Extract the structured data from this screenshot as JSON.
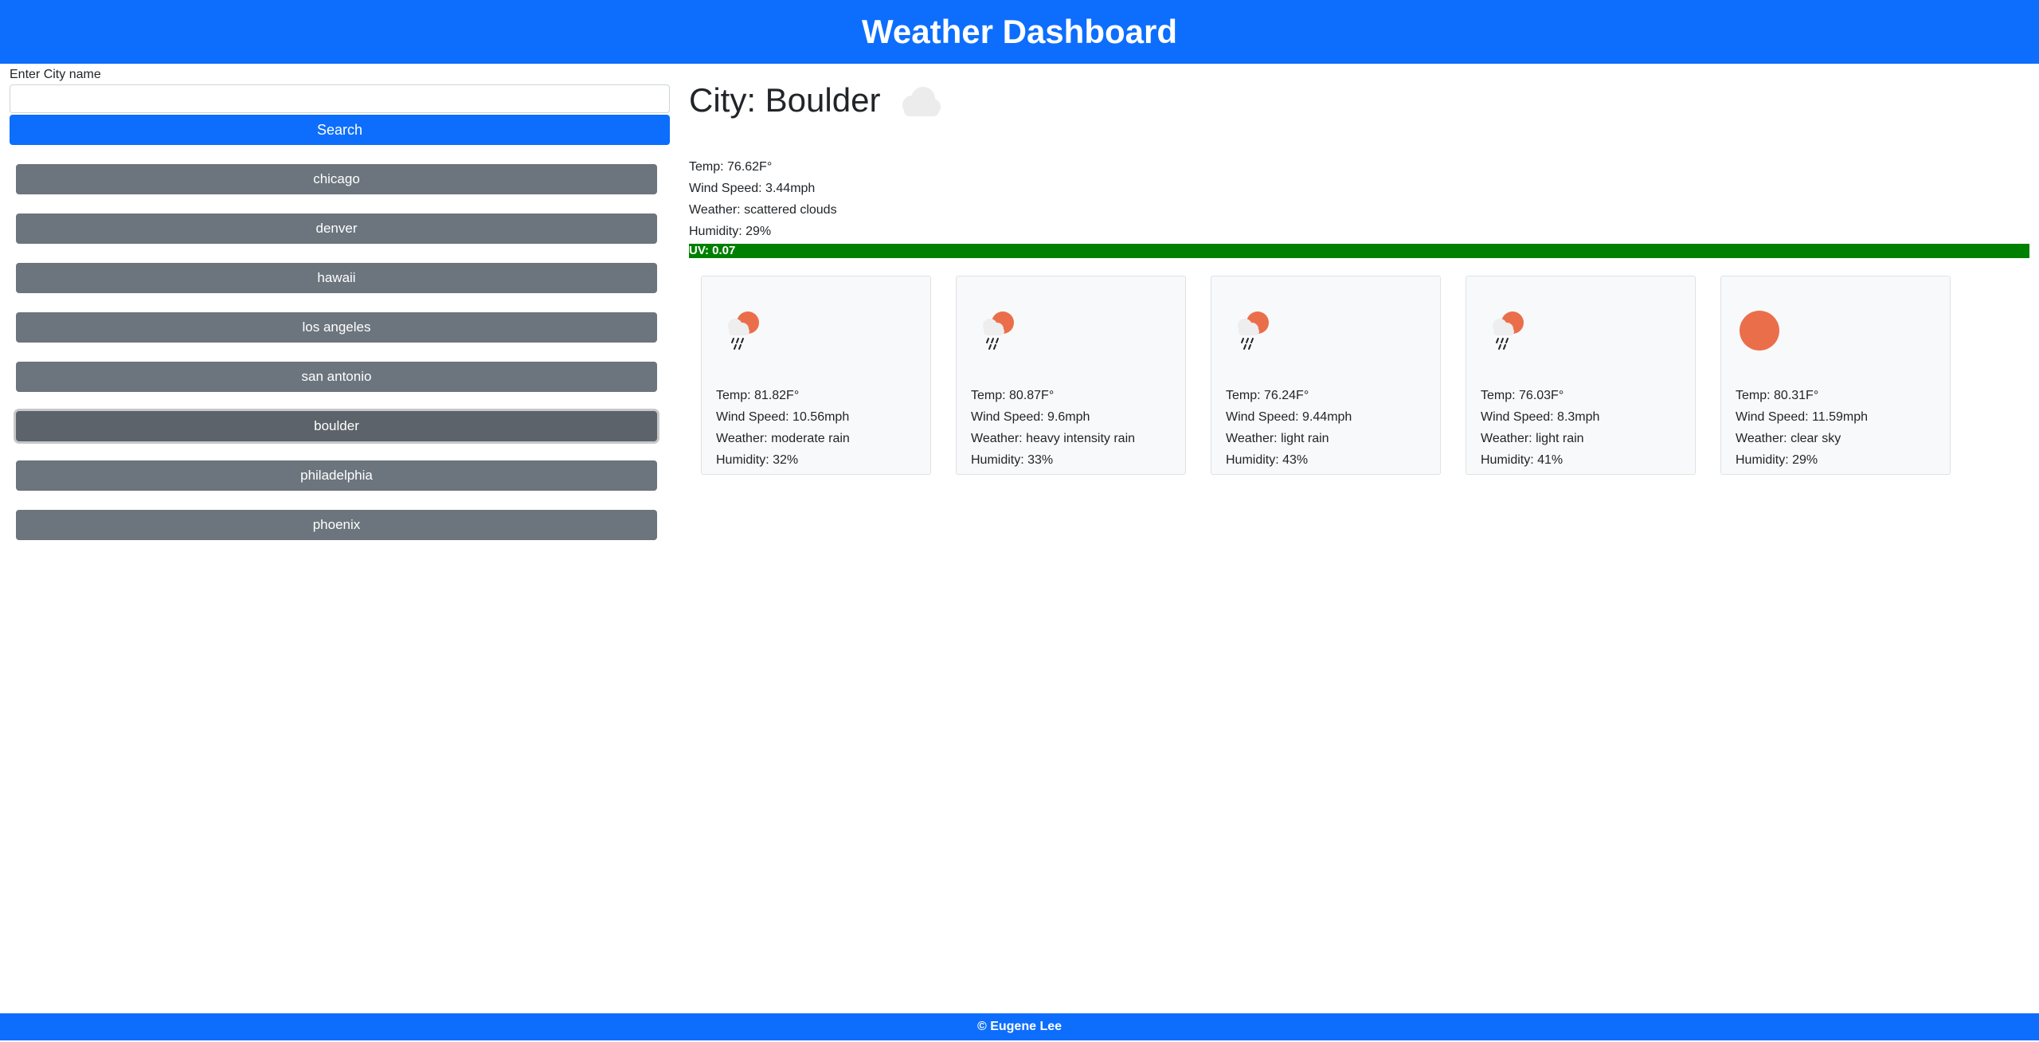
{
  "header": {
    "title": "Weather Dashboard"
  },
  "search": {
    "label": "Enter City name",
    "value": "",
    "placeholder": "",
    "button_label": "Search"
  },
  "history": [
    {
      "label": "chicago",
      "active": false
    },
    {
      "label": "denver",
      "active": false
    },
    {
      "label": "hawaii",
      "active": false
    },
    {
      "label": "los angeles",
      "active": false
    },
    {
      "label": "san antonio",
      "active": false
    },
    {
      "label": "boulder",
      "active": true
    },
    {
      "label": "philadelphia",
      "active": false
    },
    {
      "label": "phoenix",
      "active": false
    }
  ],
  "current": {
    "title": "City: Boulder",
    "icon": "cloud-icon",
    "temp": "Temp: 76.62F°",
    "wind": "Wind Speed: 3.44mph",
    "weather": "Weather: scattered clouds",
    "humidity": "Humidity: 29%",
    "uv": "UV: 0.07",
    "uv_color": "#008000"
  },
  "forecast": [
    {
      "icon": "sun-rain-icon",
      "temp": "Temp: 81.82F°",
      "wind": "Wind Speed: 10.56mph",
      "weather": "Weather: moderate rain",
      "humidity": "Humidity: 32%"
    },
    {
      "icon": "sun-rain-icon",
      "temp": "Temp: 80.87F°",
      "wind": "Wind Speed: 9.6mph",
      "weather": "Weather: heavy intensity rain",
      "humidity": "Humidity: 33%"
    },
    {
      "icon": "sun-rain-icon",
      "temp": "Temp: 76.24F°",
      "wind": "Wind Speed: 9.44mph",
      "weather": "Weather: light rain",
      "humidity": "Humidity: 43%"
    },
    {
      "icon": "sun-rain-icon",
      "temp": "Temp: 76.03F°",
      "wind": "Wind Speed: 8.3mph",
      "weather": "Weather: light rain",
      "humidity": "Humidity: 41%"
    },
    {
      "icon": "sun-icon",
      "temp": "Temp: 80.31F°",
      "wind": "Wind Speed: 11.59mph",
      "weather": "Weather: clear sky",
      "humidity": "Humidity: 29%"
    }
  ],
  "footer": {
    "text": "© Eugene Lee"
  },
  "colors": {
    "brand": "#0d6efd",
    "history_button": "#6c757d",
    "sun": "#eb6e4b"
  }
}
